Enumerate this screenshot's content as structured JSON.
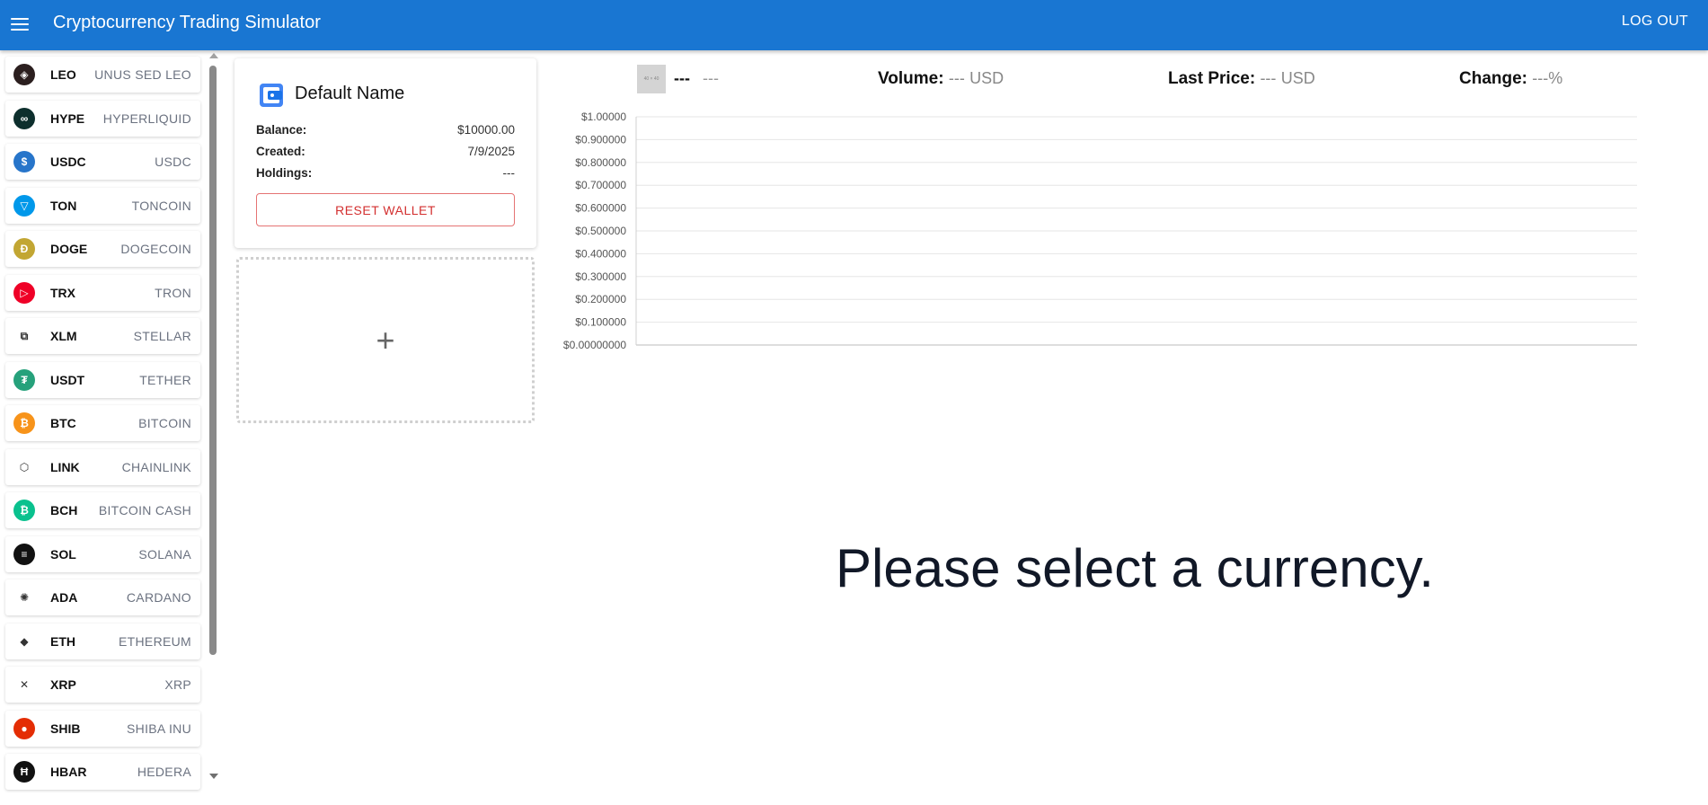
{
  "appbar": {
    "title": "Cryptocurrency Trading Simulator",
    "logout_label": "LOG OUT"
  },
  "coins": [
    {
      "symbol": "LEO",
      "name": "UNUS SED LEO",
      "color": "#2b1f1f",
      "glyph": "◈"
    },
    {
      "symbol": "HYPE",
      "name": "HYPERLIQUID",
      "color": "#0d2f2d",
      "glyph": "∞"
    },
    {
      "symbol": "USDC",
      "name": "USDC",
      "color": "#2775ca",
      "glyph": "$"
    },
    {
      "symbol": "TON",
      "name": "TONCOIN",
      "color": "#0098ea",
      "glyph": "▽"
    },
    {
      "symbol": "DOGE",
      "name": "DOGECOIN",
      "color": "#c2a633",
      "glyph": "Ð"
    },
    {
      "symbol": "TRX",
      "name": "TRON",
      "color": "#ef0027",
      "glyph": "▷"
    },
    {
      "symbol": "XLM",
      "name": "STELLAR",
      "color": "#ffffff",
      "glyph": "⧉"
    },
    {
      "symbol": "USDT",
      "name": "TETHER",
      "color": "#26a17b",
      "glyph": "₮"
    },
    {
      "symbol": "BTC",
      "name": "BITCOIN",
      "color": "#f7931a",
      "glyph": "₿"
    },
    {
      "symbol": "LINK",
      "name": "CHAINLINK",
      "color": "#ffffff",
      "glyph": "⬡"
    },
    {
      "symbol": "BCH",
      "name": "BITCOIN CASH",
      "color": "#0ac18e",
      "glyph": "₿"
    },
    {
      "symbol": "SOL",
      "name": "SOLANA",
      "color": "#111111",
      "glyph": "≡"
    },
    {
      "symbol": "ADA",
      "name": "CARDANO",
      "color": "#ffffff",
      "glyph": "✺"
    },
    {
      "symbol": "ETH",
      "name": "ETHEREUM",
      "color": "#ffffff",
      "glyph": "◆"
    },
    {
      "symbol": "XRP",
      "name": "XRP",
      "color": "#ffffff",
      "glyph": "✕"
    },
    {
      "symbol": "SHIB",
      "name": "SHIBA INU",
      "color": "#e42d04",
      "glyph": "●"
    },
    {
      "symbol": "HBAR",
      "name": "HEDERA",
      "color": "#111111",
      "glyph": "Ħ"
    }
  ],
  "wallet": {
    "name": "Default Name",
    "balance_label": "Balance:",
    "balance": "$10000.00",
    "created_label": "Created:",
    "created": "7/9/2025",
    "holdings_label": "Holdings:",
    "holdings": "---",
    "reset_label": "RESET WALLET"
  },
  "add_wallet": {
    "plus": "+"
  },
  "stats": {
    "placeholder_img": "40 × 40",
    "symbol": "---",
    "name": "---",
    "volume_label": "Volume:",
    "volume_value": "---",
    "volume_unit": "USD",
    "last_price_label": "Last Price:",
    "last_price_value": "---",
    "last_price_unit": "USD",
    "change_label": "Change:",
    "change_value": "---%"
  },
  "chart_data": {
    "type": "line",
    "title": "",
    "xlabel": "",
    "ylabel": "",
    "ylim": [
      0,
      1
    ],
    "y_tick_labels": [
      "$1.00000",
      "$0.900000",
      "$0.800000",
      "$0.700000",
      "$0.600000",
      "$0.500000",
      "$0.400000",
      "$0.300000",
      "$0.200000",
      "$0.100000",
      "$0.00000000"
    ],
    "series": [],
    "grid": true
  },
  "message": "Please select a currency.",
  "colors": {
    "appbar": "#1976d2",
    "reset_text": "#d32f2f",
    "reset_border": "#e57373"
  }
}
